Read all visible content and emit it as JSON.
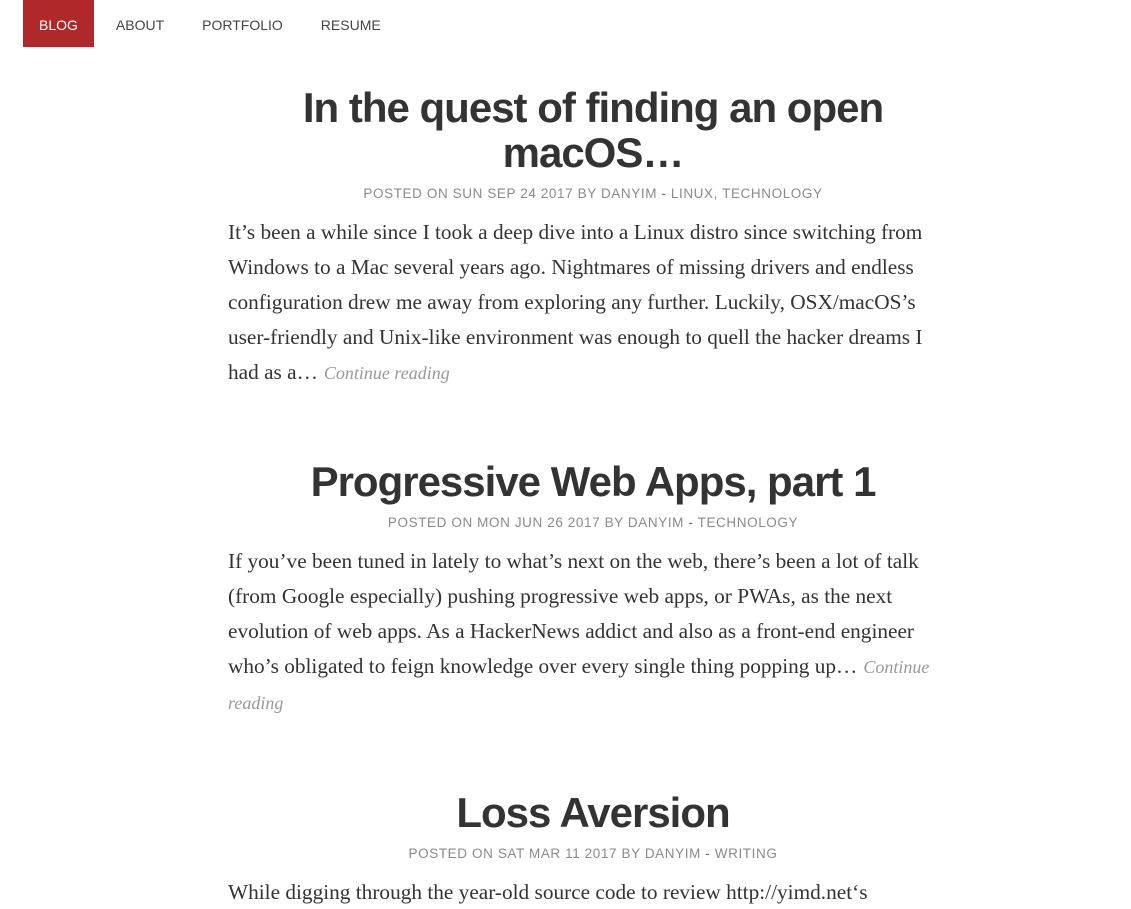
{
  "nav": {
    "items": [
      {
        "label": "BLOG",
        "active": true
      },
      {
        "label": "ABOUT",
        "active": false
      },
      {
        "label": "PORTFOLIO",
        "active": false
      },
      {
        "label": "RESUME",
        "active": false
      }
    ],
    "accent_color": "#b0282a"
  },
  "posts": [
    {
      "title": "In the quest of finding an open macOS…",
      "posted_on": "POSTED ON",
      "date": "SUN SEP 24 2017",
      "by": "BY",
      "author": "DANYIM",
      "dash": "-",
      "categories": "LINUX, TECHNOLOGY",
      "excerpt": "It’s been a while since I took a deep dive into a Linux distro since switching from Windows to a Mac several years ago. Nightmares of missing drivers and endless configuration drew me away from exploring any further. Luckily, OSX/macOS’s user-friendly and Unix-like environment was enough to quell the hacker dreams I had as a…",
      "continue": "Continue reading"
    },
    {
      "title": "Progressive Web Apps, part 1",
      "posted_on": "POSTED ON",
      "date": "MON JUN 26 2017",
      "by": "BY",
      "author": "DANYIM",
      "dash": "-",
      "categories": "TECHNOLOGY",
      "excerpt": "If you’ve been tuned in lately to what’s next on the web, there’s been a lot of talk (from Google especially) pushing progressive web apps, or PWAs,  as the next evolution of web apps. As a HackerNews addict and also as a front-end engineer who’s obligated to feign knowledge over every single thing popping up…",
      "continue": "Continue reading"
    },
    {
      "title": "Loss Aversion",
      "posted_on": "POSTED ON",
      "date": "SAT MAR 11 2017",
      "by": "BY",
      "author": "DANYIM",
      "dash": "-",
      "categories": "WRITING",
      "excerpt": "While digging through the year-old source code to review http://yimd.net‘s",
      "continue": ""
    }
  ]
}
